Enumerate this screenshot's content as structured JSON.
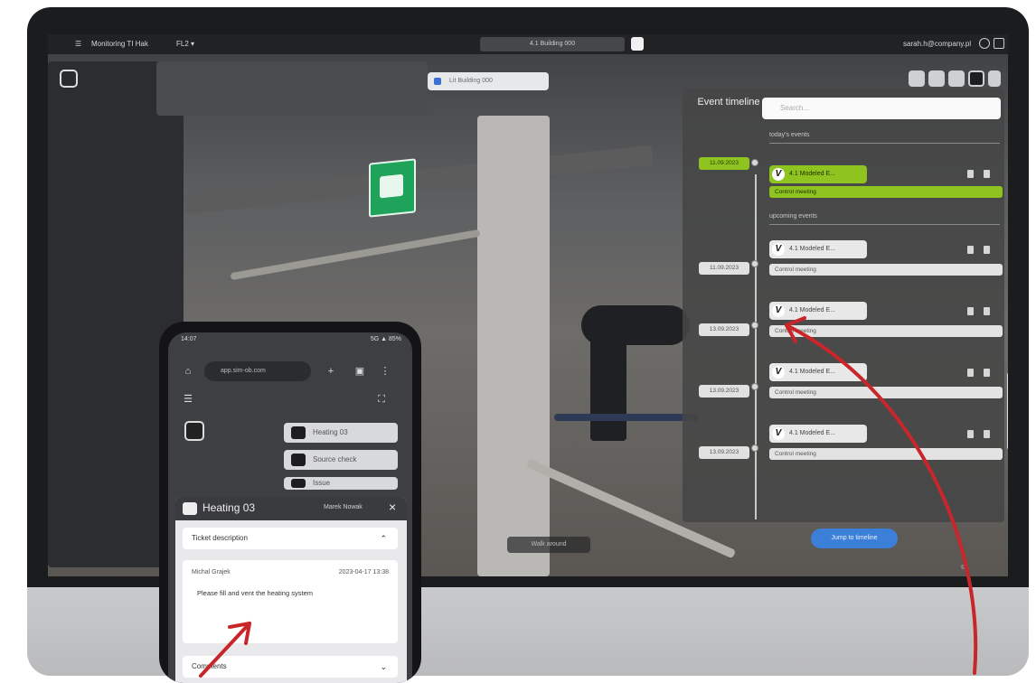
{
  "app": {
    "menu_label": "Monitoring TI Hak",
    "floor_label": "FL2 ▾",
    "view_title": "4.1 Building 000",
    "user_email": "sarah.h@company.pl"
  },
  "scene": {
    "dropdown_value": "Lit Building 000"
  },
  "timeline": {
    "title": "Event timeline",
    "search_placeholder": "Search...",
    "section_today": "today's events",
    "section_upcoming": "upcoming events",
    "events": [
      {
        "date": "11.09.2023",
        "name": "4.1 Modeled E...",
        "desc": "Control meeting",
        "highlight": true
      },
      {
        "date": "11.09.2023",
        "name": "4.1 Modeled E...",
        "desc": "Control meeting",
        "highlight": false
      },
      {
        "date": "13.09.2023",
        "name": "4.1 Modeled E...",
        "desc": "Control meeting",
        "highlight": false
      },
      {
        "date": "13.09.2023",
        "name": "4.1 Modeled E...",
        "desc": "Control meeting",
        "highlight": false
      },
      {
        "date": "13.09.2023",
        "name": "4.1 Modeled E...",
        "desc": "Control meeting",
        "highlight": false
      }
    ],
    "jump_label": "Jump to timeline",
    "bottom_tip": "Walk around"
  },
  "phone": {
    "time": "14:07",
    "signal": "5G ▲ 85%",
    "url": "app.sim-ob.com",
    "buttons": [
      "Heating 03",
      "Source check",
      "Issue"
    ],
    "sheet_title": "Heating 03",
    "sheet_sub": "Marek Nowak",
    "ticket_label": "Ticket description",
    "author": "Michal Grajek",
    "date": "2023-04-17 13:38",
    "message": "Please fill and vent the heating system",
    "comments_label": "Comments"
  },
  "colors": {
    "accent_green": "#8fc31f",
    "accent_blue": "#3c7fd9",
    "arrow_red": "#c8262b"
  }
}
